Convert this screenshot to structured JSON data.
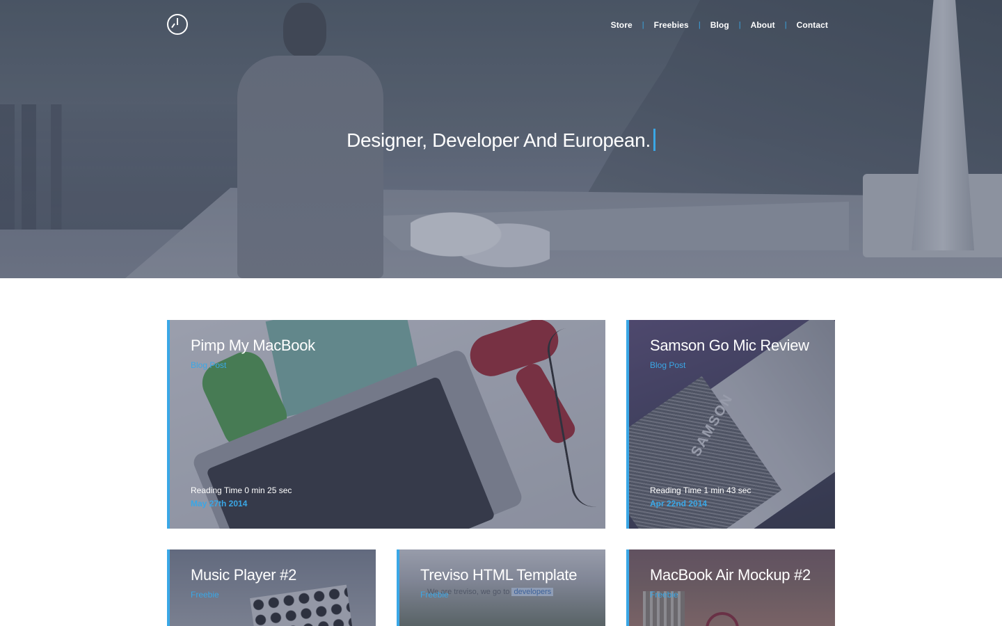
{
  "nav": {
    "items": [
      "Store",
      "Freebies",
      "Blog",
      "About",
      "Contact"
    ],
    "separator": "|"
  },
  "hero": {
    "headline": "Designer, Developer And European."
  },
  "cards": [
    {
      "title": "Pimp My MacBook",
      "category": "Blog Post",
      "reading_time": "Reading Time 0 min 25 sec",
      "date": "May 27th 2014"
    },
    {
      "title": "Samson Go Mic Review",
      "category": "Blog Post",
      "reading_time": "Reading Time 1 min 43 sec",
      "date": "Apr 22nd 2014",
      "image_text": "SAMSON"
    },
    {
      "title": "Music Player #2",
      "category": "Freebie"
    },
    {
      "title": "Treviso HTML Template",
      "category": "Freebie",
      "image_text": "We are treviso, we go to",
      "image_highlight": "developers"
    },
    {
      "title": "MacBook Air Mockup #2",
      "category": "Freebie"
    }
  ],
  "colors": {
    "accent": "#3aa7e6",
    "text_on_image": "#ffffff"
  },
  "icons": {
    "logo": "clock-icon"
  }
}
